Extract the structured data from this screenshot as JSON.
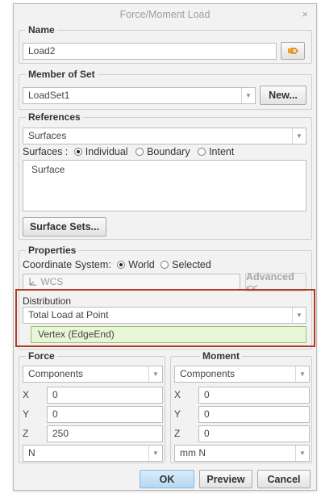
{
  "dialog": {
    "title": "Force/Moment Load",
    "close_glyph": "×"
  },
  "name_group": {
    "label": "Name",
    "value": "Load2",
    "color_button_icon": "load-color-icon"
  },
  "member_group": {
    "label": "Member of Set",
    "selected": "LoadSet1",
    "new_button": "New..."
  },
  "references": {
    "label": "References",
    "type_selected": "Surfaces",
    "surfaces_label": "Surfaces :",
    "options": [
      "Individual",
      "Boundary",
      "Intent"
    ],
    "selected_option": "Individual",
    "list_items": [
      "Surface"
    ],
    "surface_sets_button": "Surface Sets..."
  },
  "properties": {
    "label": "Properties",
    "coord_label": "Coordinate System:",
    "coord_options": [
      "World",
      "Selected"
    ],
    "coord_selected": "World",
    "csys_value": "WCS",
    "advanced_button": "Advanced <<",
    "distribution_label": "Distribution",
    "distribution_selected": "Total Load at Point",
    "vertex_value": "Vertex (EdgeEnd)"
  },
  "force": {
    "label": "Force",
    "mode": "Components",
    "x": "0",
    "y": "0",
    "z": "250",
    "units": "N"
  },
  "moment": {
    "label": "Moment",
    "mode": "Components",
    "x": "0",
    "y": "0",
    "z": "0",
    "units": "mm N"
  },
  "axes": {
    "x": "X",
    "y": "Y",
    "z": "Z"
  },
  "footer": {
    "ok": "OK",
    "preview": "Preview",
    "cancel": "Cancel"
  },
  "colors": {
    "highlight_border": "#b23b24",
    "vertex_fill": "#eaf6d8",
    "ok_button": "#b7d8f1"
  }
}
